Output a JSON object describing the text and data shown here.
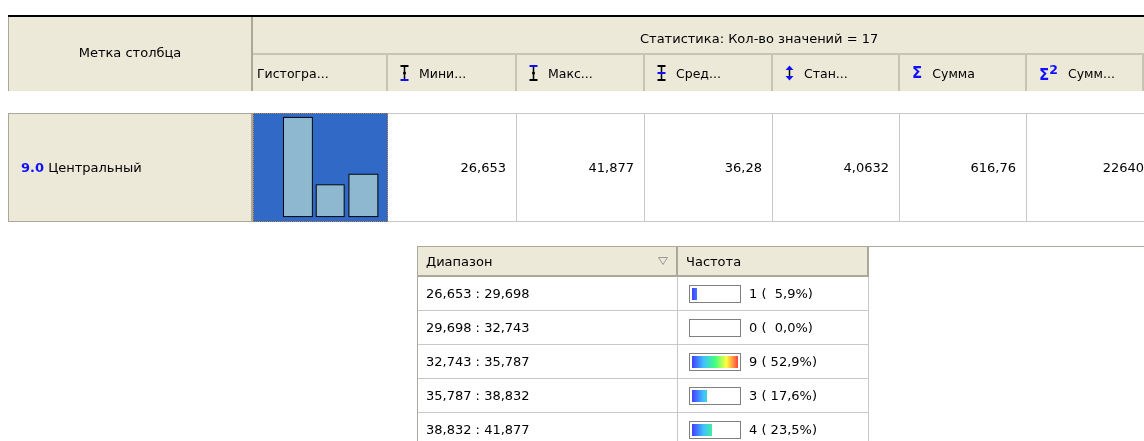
{
  "table": {
    "row_header_label": "Метка столбца",
    "group_header": "Статистика: Кол-во значений = 17",
    "columns": [
      {
        "kind": "plain",
        "label": "Гистогра..."
      },
      {
        "kind": "min",
        "label": "Мини..."
      },
      {
        "kind": "max",
        "label": "Макс..."
      },
      {
        "kind": "mean",
        "label": "Сред..."
      },
      {
        "kind": "std",
        "label": "Стан..."
      },
      {
        "kind": "sum",
        "symbol": "Σ",
        "label": "Сумма"
      },
      {
        "kind": "sum",
        "symbol": "Σ$^{2}$",
        "label": "Сумм..."
      }
    ],
    "rows": [
      {
        "number": "9.0",
        "label": "Центральный",
        "histogram_selected": true,
        "cells": [
          "26,653",
          "41,877",
          "36,28",
          "4,0632",
          "616,76",
          "22640"
        ]
      }
    ]
  },
  "bins_table": {
    "columns": [
      {
        "label": "Диапазон",
        "sorted": true
      },
      {
        "label": "Частота"
      }
    ],
    "rows": [
      {
        "range": "26,653 : 29,698",
        "level": 0.11,
        "count": "1 (  5,9%)"
      },
      {
        "range": "29,698 : 32,743",
        "level": 0,
        "count": "0 (  0,0%)"
      },
      {
        "range": "32,743 : 35,787",
        "level": 1,
        "count": "9 ( 52,9%)"
      },
      {
        "range": "35,787 : 38,832",
        "level": 0.33,
        "count": "3 ( 17,6%)"
      },
      {
        "range": "38,832 : 41,877",
        "level": 0.44,
        "count": "4 ( 23,5%)"
      }
    ]
  }
}
